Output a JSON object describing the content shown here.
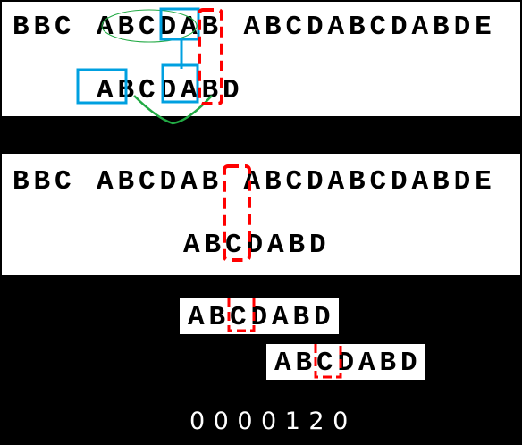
{
  "step1": {
    "text": "BBC ABCDAB ABCDABCDABDE",
    "pattern": "ABCDABD"
  },
  "step2": {
    "text": "BBC ABCDAB ABCDABCDABDE",
    "pattern": "ABCDABD"
  },
  "shift": {
    "before": "ABCDABD",
    "after": "ABCDABD"
  },
  "next_array": "0000120",
  "colors": {
    "mismatch": "#ff0000",
    "prefix_box": "#00a0e0",
    "match_curve": "#22aa44"
  }
}
